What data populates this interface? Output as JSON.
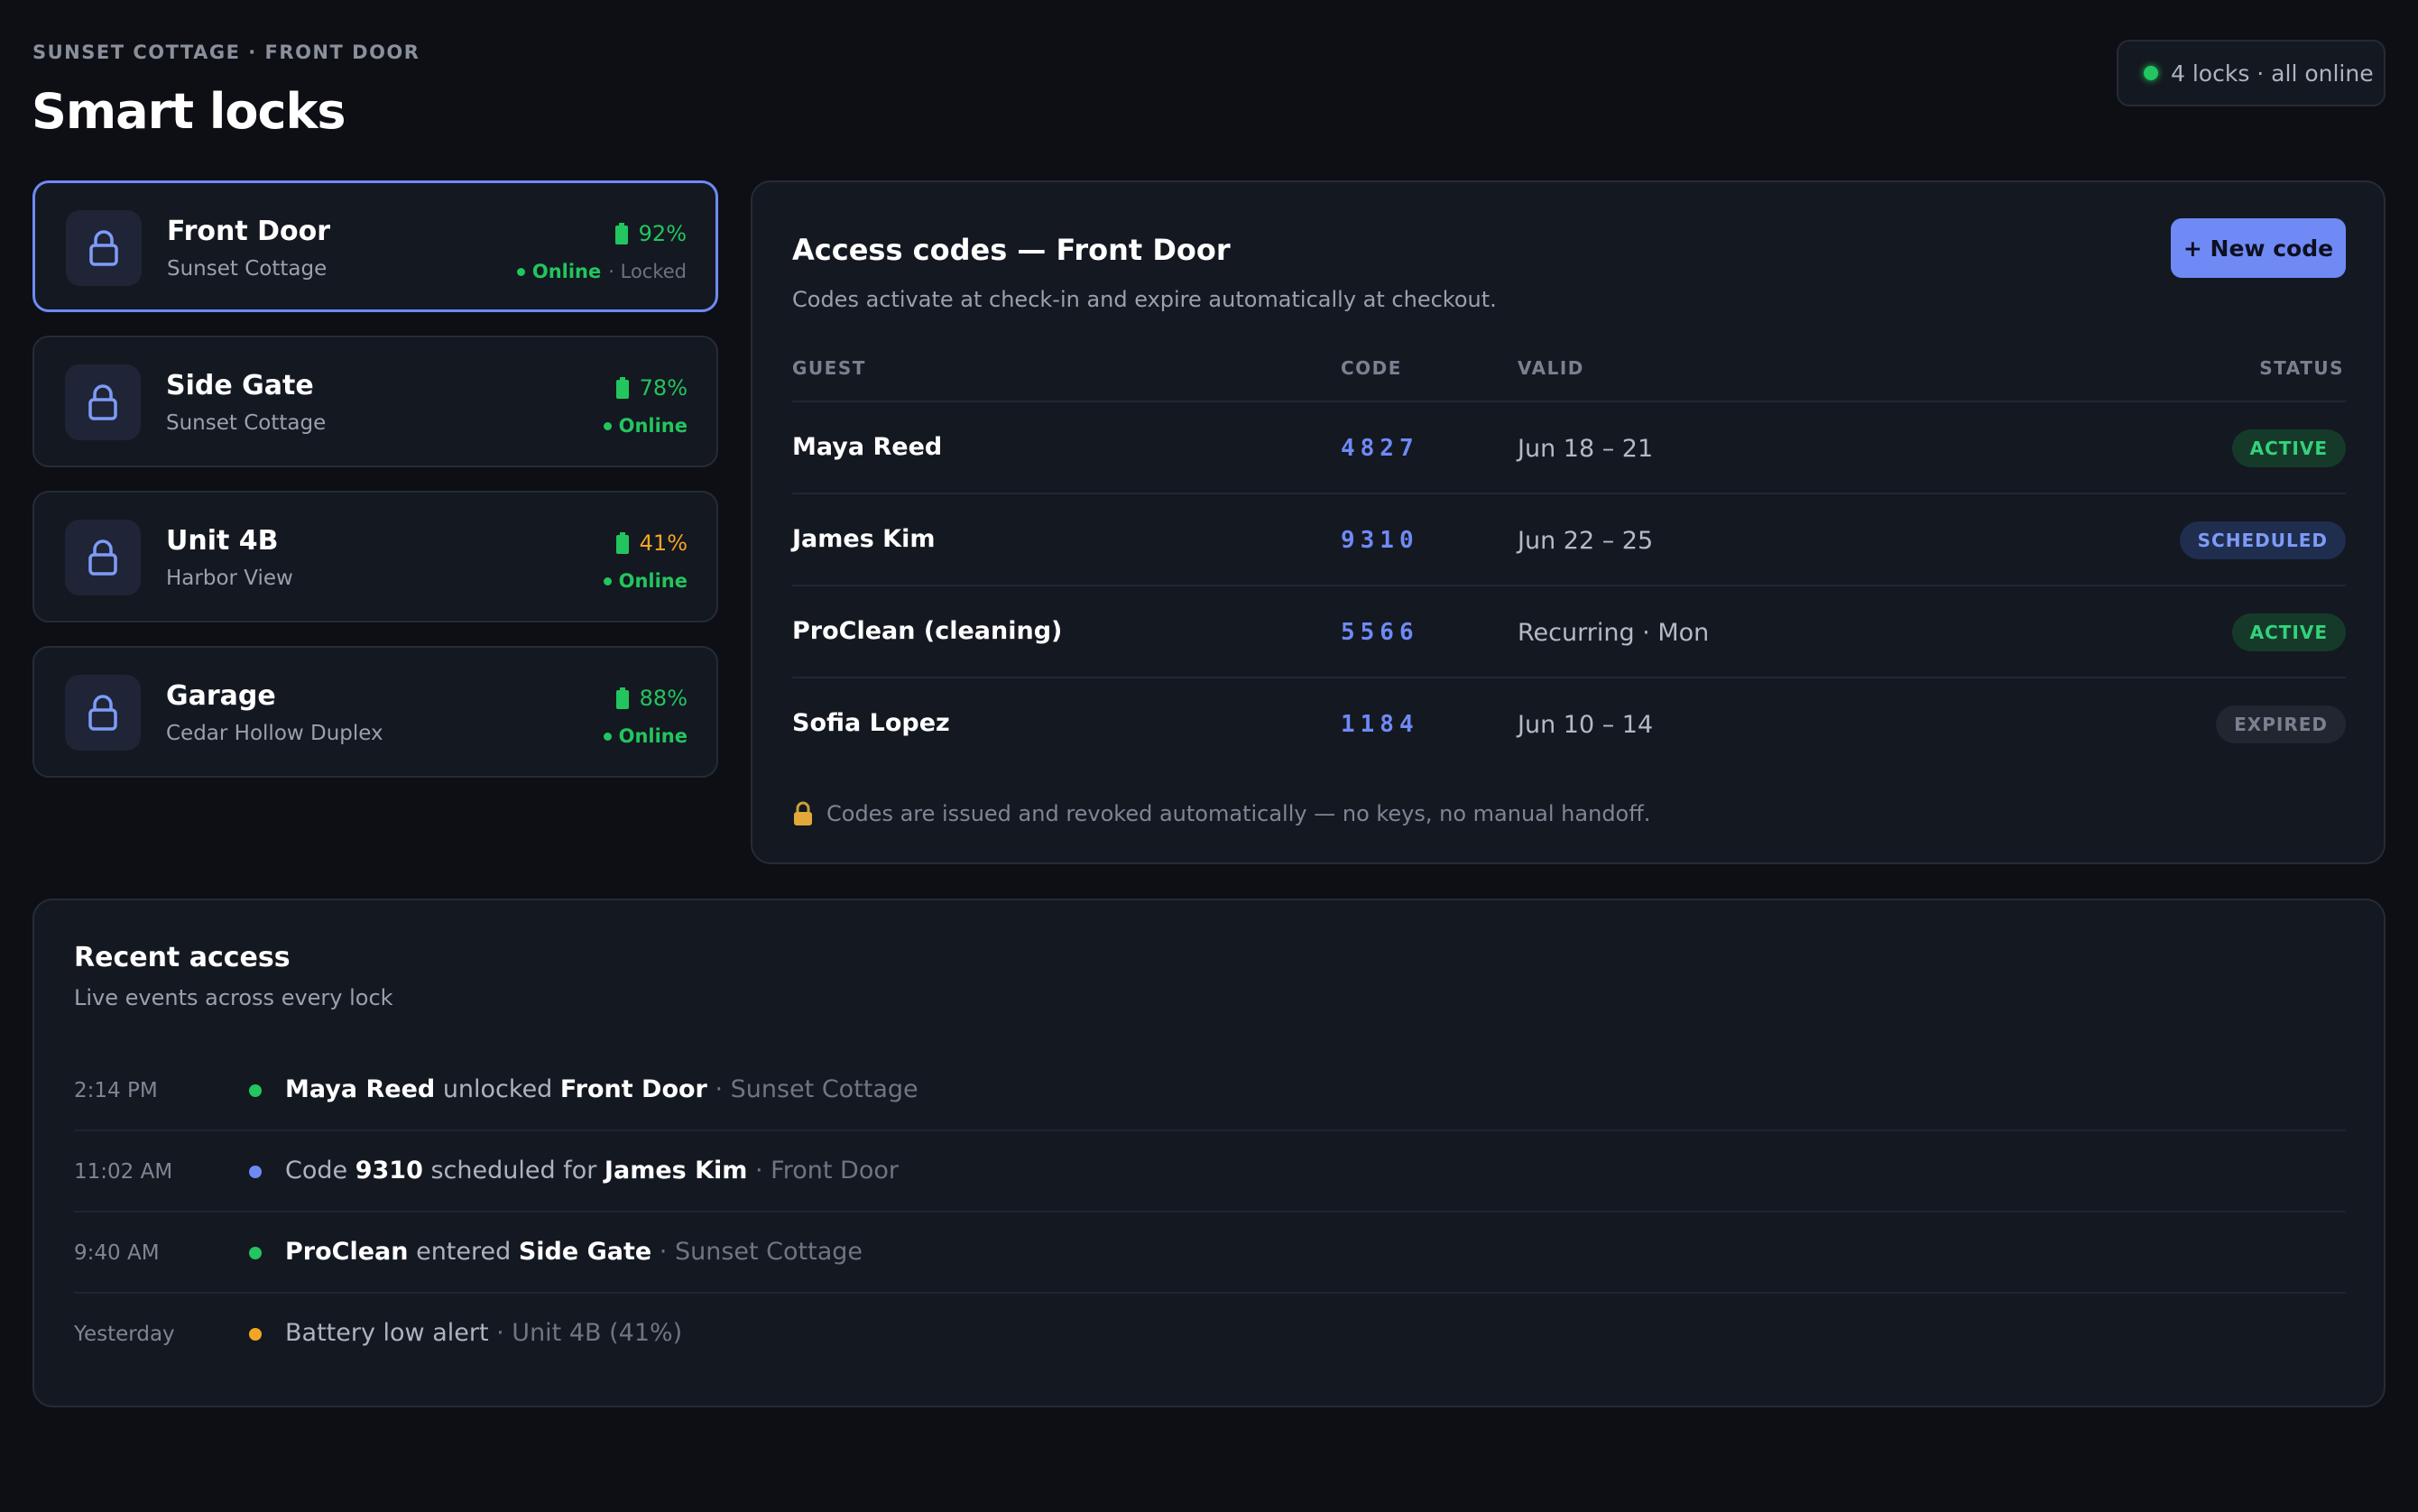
{
  "header": {
    "breadcrumb": "SUNSET COTTAGE · FRONT DOOR",
    "title": "Smart locks",
    "status_pill": "4 locks · all online"
  },
  "colors": {
    "accent": "#6f8af5",
    "online": "#22c55e",
    "battery_ok": "#22c55e",
    "battery_low": "#f5a524"
  },
  "locks": [
    {
      "name": "Front Door",
      "location": "Sunset Cottage",
      "battery": "92%",
      "status": "Online",
      "state": "Locked",
      "icon": "lock-icon"
    },
    {
      "name": "Side Gate",
      "location": "Sunset Cottage",
      "battery": "78%",
      "status": "Online",
      "icon": "lock-icon"
    },
    {
      "name": "Unit 4B",
      "location": "Harbor View",
      "battery": "41%",
      "status": "Online",
      "icon": "lock-icon"
    },
    {
      "name": "Garage",
      "location": "Cedar Hollow Duplex",
      "battery": "88%",
      "status": "Online",
      "icon": "lock-icon"
    }
  ],
  "codes": {
    "title": "Access codes — Front Door",
    "subtitle": "Codes activate at check-in and expire automatically at checkout.",
    "new_button": "+ New code",
    "columns": {
      "guest": "GUEST",
      "code": "CODE",
      "valid": "VALID",
      "status": "STATUS"
    },
    "rows": [
      {
        "guest": "Maya Reed",
        "code": "4827",
        "valid": "Jun 18 – 21",
        "status": "ACTIVE"
      },
      {
        "guest": "James Kim",
        "code": "9310",
        "valid": "Jun 22 – 25",
        "status": "SCHEDULED"
      },
      {
        "guest": "ProClean (cleaning)",
        "code": "5566",
        "valid": "Recurring · Mon",
        "status": "ACTIVE"
      },
      {
        "guest": "Sofia Lopez",
        "code": "1184",
        "valid": "Jun 10 – 14",
        "status": "EXPIRED"
      }
    ],
    "footer": "Codes are issued and revoked automatically — no keys, no manual handoff."
  },
  "recent": {
    "title": "Recent access",
    "subtitle": "Live events across every lock",
    "events": [
      {
        "time": "2:14 PM",
        "dot_color": "#22c55e",
        "actor": "Maya Reed",
        "verb": "unlocked",
        "target": "Front Door",
        "context": "· Sunset Cottage"
      },
      {
        "time": "11:02 AM",
        "dot_color": "#6f8af5",
        "prefix": "Code",
        "code": "9310",
        "verb": "scheduled for",
        "target": "James Kim",
        "context": "· Front Door"
      },
      {
        "time": "9:40 AM",
        "dot_color": "#22c55e",
        "actor": "ProClean",
        "verb": "entered",
        "target": "Side Gate",
        "context": "· Sunset Cottage"
      },
      {
        "time": "Yesterday",
        "dot_color": "#f5a524",
        "text": "Battery low alert",
        "context": "· Unit 4B (41%)"
      }
    ]
  }
}
